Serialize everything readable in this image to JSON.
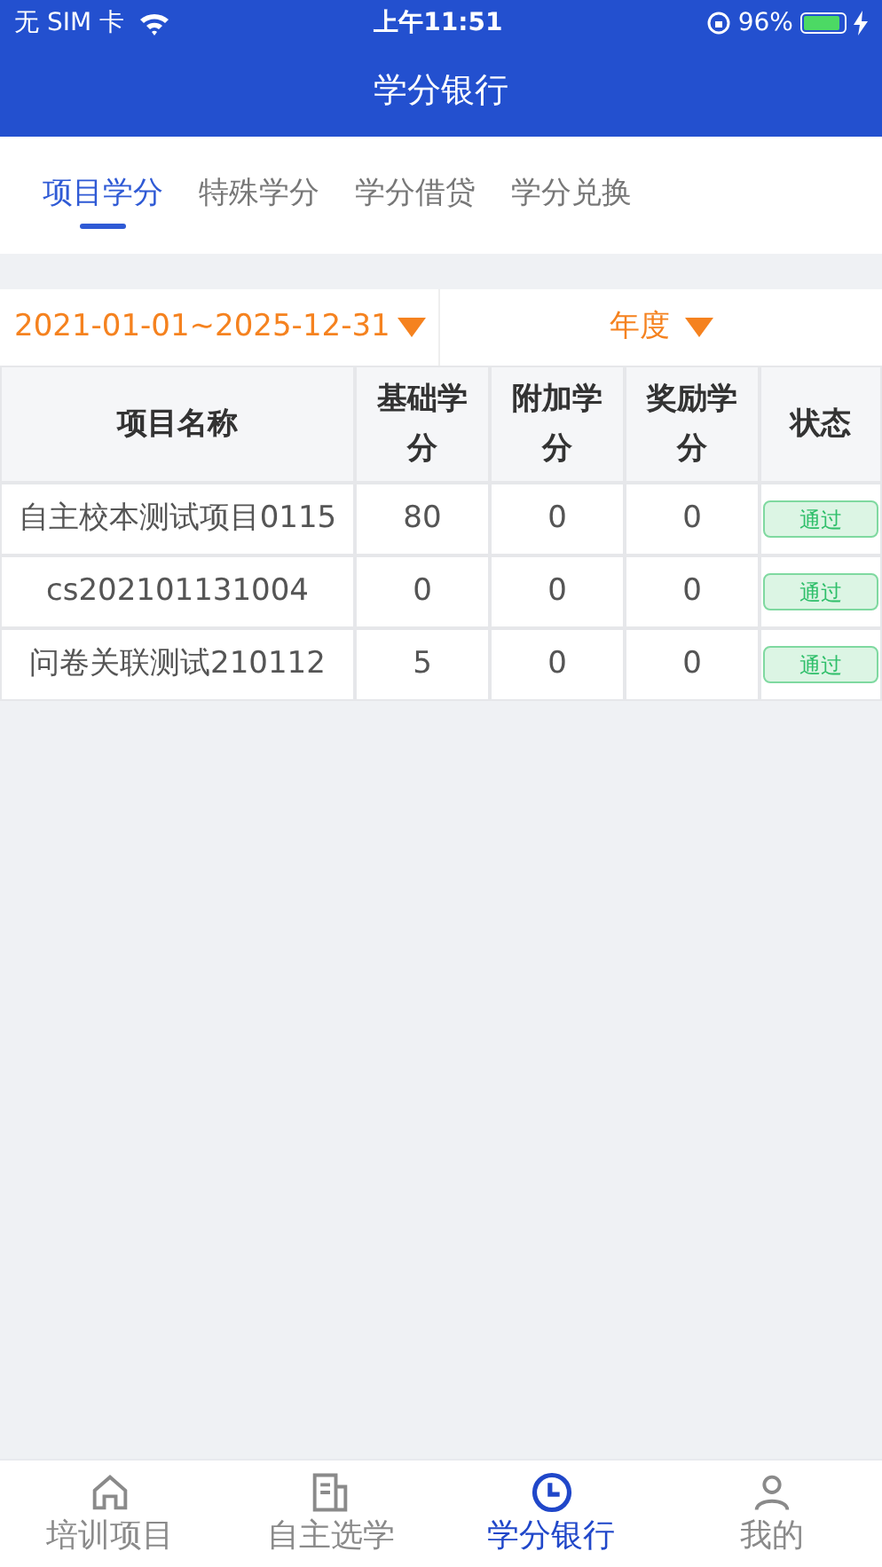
{
  "status_bar": {
    "carrier": "无 SIM 卡",
    "time": "上午11:51",
    "battery": "96%"
  },
  "header": {
    "title": "学分银行"
  },
  "tabs": [
    {
      "label": "项目学分",
      "selected": true
    },
    {
      "label": "特殊学分",
      "selected": false
    },
    {
      "label": "学分借贷",
      "selected": false
    },
    {
      "label": "学分兑换",
      "selected": false
    }
  ],
  "filters": {
    "date_range": "2021-01-01~2025-12-31",
    "period": "年度"
  },
  "table": {
    "columns": [
      "项目名称",
      "基础学分",
      "附加学分",
      "奖励学分",
      "状态"
    ],
    "rows": [
      {
        "name": "自主校本测试项目0115",
        "base": "80",
        "extra": "0",
        "reward": "0",
        "status": "通过"
      },
      {
        "name": "cs202101131004",
        "base": "0",
        "extra": "0",
        "reward": "0",
        "status": "通过"
      },
      {
        "name": "问卷关联测试210112",
        "base": "5",
        "extra": "0",
        "reward": "0",
        "status": "通过"
      }
    ]
  },
  "bottom_nav": [
    {
      "label": "培训项目",
      "kind": "home",
      "selected": false
    },
    {
      "label": "自主选学",
      "kind": "doc",
      "selected": false
    },
    {
      "label": "学分银行",
      "kind": "clock",
      "selected": true
    },
    {
      "label": "我的",
      "kind": "person",
      "selected": false
    }
  ]
}
